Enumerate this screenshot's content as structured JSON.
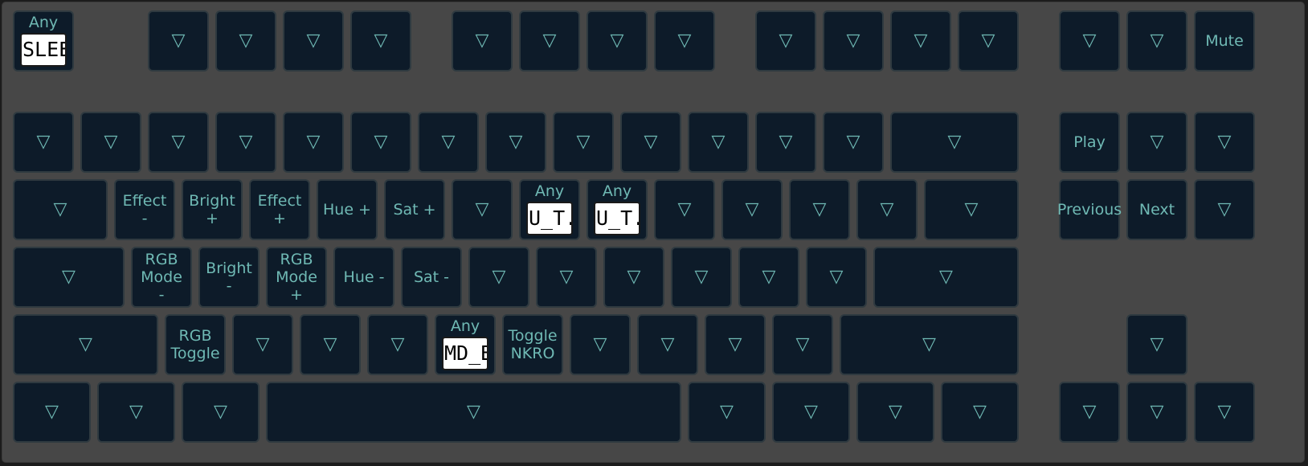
{
  "triangle_glyph": "▽",
  "any_label": "Any",
  "keys": [
    {
      "id": "esc",
      "type": "any",
      "value": "SLEEP"
    },
    {
      "id": "f1",
      "type": "tri"
    },
    {
      "id": "f2",
      "type": "tri"
    },
    {
      "id": "f3",
      "type": "tri"
    },
    {
      "id": "f4",
      "type": "tri"
    },
    {
      "id": "f5",
      "type": "tri"
    },
    {
      "id": "f6",
      "type": "tri"
    },
    {
      "id": "f7",
      "type": "tri"
    },
    {
      "id": "f8",
      "type": "tri"
    },
    {
      "id": "f9",
      "type": "tri"
    },
    {
      "id": "f10",
      "type": "tri"
    },
    {
      "id": "f11",
      "type": "tri"
    },
    {
      "id": "f12",
      "type": "tri"
    },
    {
      "id": "prtsc",
      "type": "tri"
    },
    {
      "id": "scrlk",
      "type": "tri"
    },
    {
      "id": "mute",
      "type": "label",
      "label": "Mute"
    },
    {
      "id": "grave",
      "type": "tri"
    },
    {
      "id": "n1",
      "type": "tri"
    },
    {
      "id": "n2",
      "type": "tri"
    },
    {
      "id": "n3",
      "type": "tri"
    },
    {
      "id": "n4",
      "type": "tri"
    },
    {
      "id": "n5",
      "type": "tri"
    },
    {
      "id": "n6",
      "type": "tri"
    },
    {
      "id": "n7",
      "type": "tri"
    },
    {
      "id": "n8",
      "type": "tri"
    },
    {
      "id": "n9",
      "type": "tri"
    },
    {
      "id": "n0",
      "type": "tri"
    },
    {
      "id": "minus",
      "type": "tri"
    },
    {
      "id": "equal",
      "type": "tri"
    },
    {
      "id": "backspace",
      "type": "tri"
    },
    {
      "id": "play",
      "type": "label",
      "label": "Play"
    },
    {
      "id": "home",
      "type": "tri"
    },
    {
      "id": "pgup",
      "type": "tri"
    },
    {
      "id": "tab",
      "type": "tri"
    },
    {
      "id": "q",
      "type": "label",
      "label": "Effect\n-"
    },
    {
      "id": "w",
      "type": "label",
      "label": "Bright\n+"
    },
    {
      "id": "e",
      "type": "label",
      "label": "Effect\n+"
    },
    {
      "id": "r",
      "type": "label",
      "label": "Hue +"
    },
    {
      "id": "t",
      "type": "label",
      "label": "Sat +"
    },
    {
      "id": "y",
      "type": "tri"
    },
    {
      "id": "u",
      "type": "any",
      "value": "U_T."
    },
    {
      "id": "i",
      "type": "any",
      "value": "U_T."
    },
    {
      "id": "o",
      "type": "tri"
    },
    {
      "id": "p",
      "type": "tri"
    },
    {
      "id": "lbracket",
      "type": "tri"
    },
    {
      "id": "rbracket",
      "type": "tri"
    },
    {
      "id": "backslash",
      "type": "tri"
    },
    {
      "id": "previous",
      "type": "label",
      "label": "Previous"
    },
    {
      "id": "next",
      "type": "label",
      "label": "Next"
    },
    {
      "id": "pgdn",
      "type": "tri"
    },
    {
      "id": "caps",
      "type": "tri"
    },
    {
      "id": "a",
      "type": "label",
      "label": "RGB\nMode\n-"
    },
    {
      "id": "s",
      "type": "label",
      "label": "Bright\n-"
    },
    {
      "id": "d",
      "type": "label",
      "label": "RGB\nMode\n+"
    },
    {
      "id": "f",
      "type": "label",
      "label": "Hue -"
    },
    {
      "id": "g",
      "type": "label",
      "label": "Sat -"
    },
    {
      "id": "h",
      "type": "tri"
    },
    {
      "id": "j",
      "type": "tri"
    },
    {
      "id": "k",
      "type": "tri"
    },
    {
      "id": "l",
      "type": "tri"
    },
    {
      "id": "semicolon",
      "type": "tri"
    },
    {
      "id": "quote",
      "type": "tri"
    },
    {
      "id": "enter",
      "type": "tri"
    },
    {
      "id": "lshift",
      "type": "tri"
    },
    {
      "id": "z",
      "type": "label",
      "label": "RGB\nToggle"
    },
    {
      "id": "x",
      "type": "tri"
    },
    {
      "id": "c",
      "type": "tri"
    },
    {
      "id": "v",
      "type": "tri"
    },
    {
      "id": "b",
      "type": "any",
      "value": "MD_BOOT"
    },
    {
      "id": "n",
      "type": "label",
      "label": "Toggle\nNKRO"
    },
    {
      "id": "m",
      "type": "tri"
    },
    {
      "id": "comma",
      "type": "tri"
    },
    {
      "id": "period",
      "type": "tri"
    },
    {
      "id": "slash",
      "type": "tri"
    },
    {
      "id": "rshift",
      "type": "tri"
    },
    {
      "id": "up",
      "type": "tri"
    },
    {
      "id": "lctrl",
      "type": "tri"
    },
    {
      "id": "lgui",
      "type": "tri"
    },
    {
      "id": "lalt",
      "type": "tri"
    },
    {
      "id": "space",
      "type": "tri"
    },
    {
      "id": "ralt",
      "type": "tri"
    },
    {
      "id": "fn",
      "type": "tri"
    },
    {
      "id": "menu",
      "type": "tri"
    },
    {
      "id": "rctrl",
      "type": "tri"
    },
    {
      "id": "left",
      "type": "tri"
    },
    {
      "id": "down",
      "type": "tri"
    },
    {
      "id": "right",
      "type": "tri"
    }
  ]
}
